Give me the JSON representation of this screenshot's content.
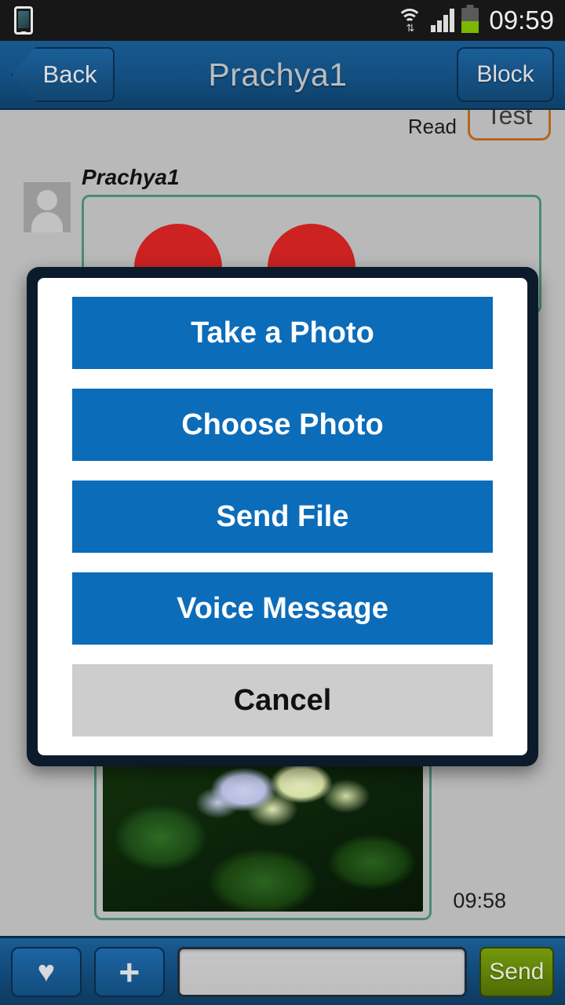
{
  "statusbar": {
    "time": "09:59",
    "icons": [
      "phone-icon",
      "wifi-icon",
      "signal-icon",
      "battery-icon"
    ],
    "wifi_updown": "⇅",
    "background": "#171717"
  },
  "header": {
    "back_label": "Back",
    "title": "Prachya1",
    "block_label": "Block",
    "gradient_top": "#18598f",
    "gradient_bottom": "#0e3f69"
  },
  "chat": {
    "outgoing": {
      "status": "Read",
      "text": "Test",
      "border_color": "#b5651d"
    },
    "incoming": {
      "sender": "Prachya1",
      "border_color": "#4c8a76",
      "sticker_color": "#cc2222"
    },
    "photo_message": {
      "time": "09:58",
      "border_color": "#4c8a76"
    },
    "background": "#b9b9b9"
  },
  "dialog": {
    "frame_color": "#0b1b2b",
    "accent": "#0b6cba",
    "buttons": [
      {
        "label": "Take a Photo",
        "name": "take-a-photo-button"
      },
      {
        "label": "Choose Photo",
        "name": "choose-photo-button"
      },
      {
        "label": "Send File",
        "name": "send-file-button"
      },
      {
        "label": "Voice Message",
        "name": "voice-message-button"
      }
    ],
    "cancel_label": "Cancel",
    "cancel_color": "#cdcdcd"
  },
  "toolbar": {
    "heart_icon": "♥",
    "plus_icon": "+",
    "input_value": "",
    "input_placeholder": "",
    "send_label": "Send",
    "send_color": "#74990b"
  }
}
